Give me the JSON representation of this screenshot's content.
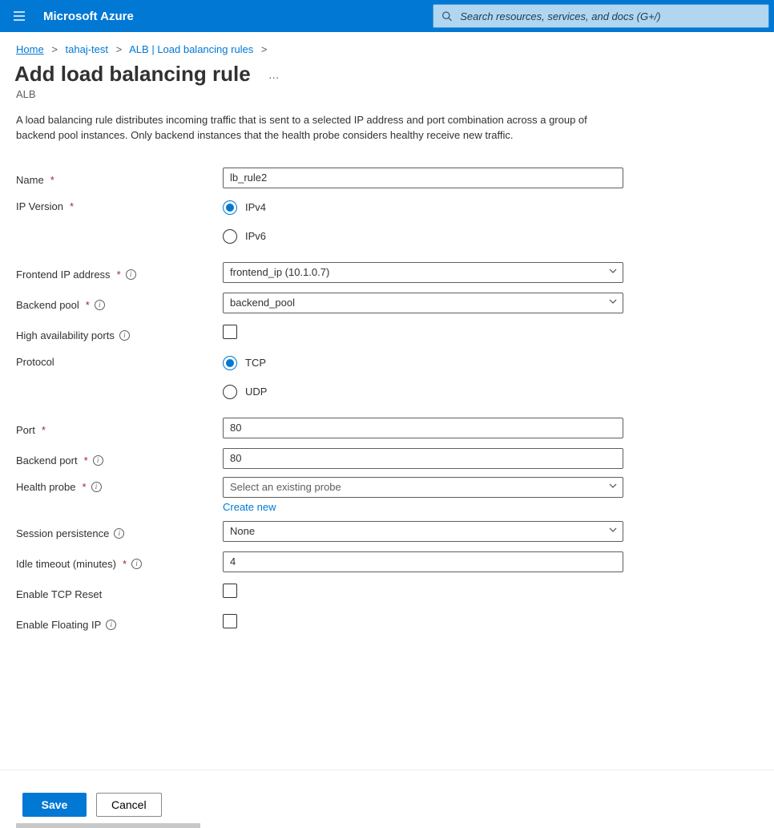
{
  "header": {
    "brand": "Microsoft Azure",
    "search_placeholder": "Search resources, services, and docs (G+/)"
  },
  "crumbs": {
    "items": [
      "Home",
      "tahaj-test",
      "ALB | Load balancing rules"
    ]
  },
  "page": {
    "title": "Add load balancing rule",
    "subtitle": "ALB",
    "description": "A load balancing rule distributes incoming traffic that is sent to a selected IP address and port combination across a group of backend pool instances. Only backend instances that the health probe considers healthy receive new traffic."
  },
  "form": {
    "name": {
      "label": "Name",
      "value": "lb_rule2"
    },
    "ip_version": {
      "label": "IP Version",
      "options": [
        "IPv4",
        "IPv6"
      ],
      "selected": "IPv4"
    },
    "frontend_ip": {
      "label": "Frontend IP address",
      "value": "frontend_ip (10.1.0.7)"
    },
    "backend_pool": {
      "label": "Backend pool",
      "value": "backend_pool"
    },
    "ha_ports": {
      "label": "High availability ports"
    },
    "protocol": {
      "label": "Protocol",
      "options": [
        "TCP",
        "UDP"
      ],
      "selected": "TCP"
    },
    "port": {
      "label": "Port",
      "value": "80"
    },
    "backend_port": {
      "label": "Backend port",
      "value": "80"
    },
    "health_probe": {
      "label": "Health probe",
      "placeholder": "Select an existing probe",
      "create_new": "Create new"
    },
    "session_persistence": {
      "label": "Session persistence",
      "value": "None"
    },
    "idle_timeout": {
      "label": "Idle timeout (minutes)",
      "value": "4"
    },
    "tcp_reset": {
      "label": "Enable TCP Reset"
    },
    "floating_ip": {
      "label": "Enable Floating IP"
    }
  },
  "footer": {
    "save": "Save",
    "cancel": "Cancel"
  }
}
